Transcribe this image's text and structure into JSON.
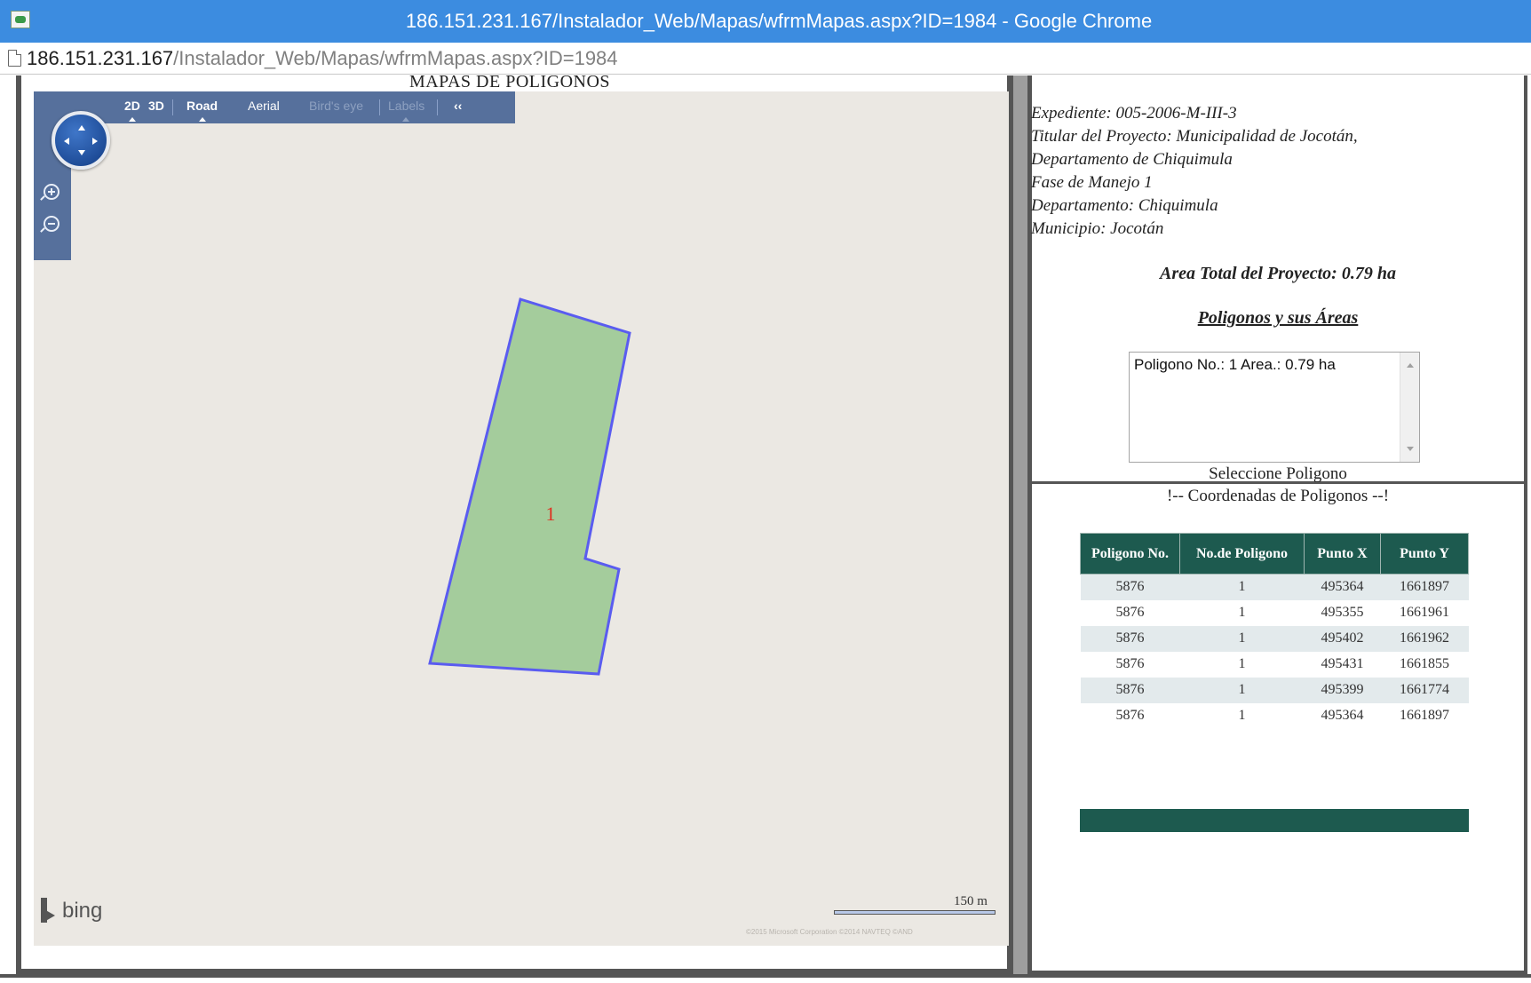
{
  "window": {
    "title": "186.151.231.167/Instalador_Web/Mapas/wfrmMapas.aspx?ID=1984 - Google Chrome"
  },
  "address": {
    "host": "186.151.231.167",
    "path": "/Instalador_Web/Mapas/wfrmMapas.aspx?ID=1984"
  },
  "map": {
    "title": "MAPAS DE POLIGONOS",
    "nav": {
      "view_2d": "2D",
      "view_3d": "3D",
      "road": "Road",
      "aerial": "Aerial",
      "birds_eye": "Bird's eye",
      "labels": "Labels",
      "collapse": "‹‹"
    },
    "polygon_label": "1",
    "polygon_fill": "#a4cc9c",
    "polygon_stroke": "#5a5cf0",
    "label_color": "#e03020",
    "logo_text": "bing",
    "scale_label": "150 m",
    "copyright": "©2015 Microsoft Corporation   ©2014 NAVTEQ   ©AND"
  },
  "info": {
    "expediente": "Expediente: 005-2006-M-III-3",
    "titular_1": "Titular del Proyecto: Municipalidad de Jocotán,",
    "titular_2": "Departamento de Chiquimula",
    "fase": "Fase de Manejo 1",
    "departamento": "Departamento: Chiquimula",
    "municipio": "Municipio: Jocotán",
    "area_total": "Area Total del Proyecto: 0.79 ha",
    "polygons_heading": "Poligonos y sus Áreas",
    "list_items": [
      "Poligono No.: 1 Area.: 0.79 ha"
    ],
    "select_label": "Seleccione Poligono",
    "coords_label": "!-- Coordenadas de Poligonos --!"
  },
  "table": {
    "headers": [
      "Poligono No.",
      "No.de Poligono",
      "Punto X",
      "Punto Y"
    ],
    "rows": [
      [
        "5876",
        "1",
        "495364",
        "1661897"
      ],
      [
        "5876",
        "1",
        "495355",
        "1661961"
      ],
      [
        "5876",
        "1",
        "495402",
        "1661962"
      ],
      [
        "5876",
        "1",
        "495431",
        "1661855"
      ],
      [
        "5876",
        "1",
        "495399",
        "1661774"
      ],
      [
        "5876",
        "1",
        "495364",
        "1661897"
      ]
    ],
    "header_color": "#1d5a4f"
  }
}
